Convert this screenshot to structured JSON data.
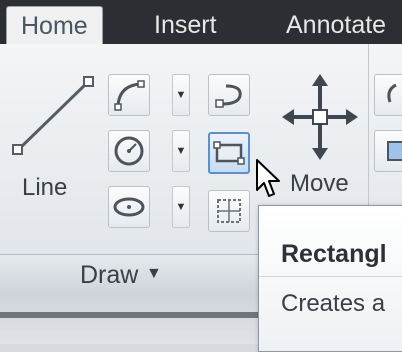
{
  "tabs": [
    {
      "label": "Home"
    },
    {
      "label": "Insert"
    },
    {
      "label": "Annotate"
    }
  ],
  "draw": {
    "line_label": "Line",
    "panel_title": "Draw",
    "panel_arrow": "▼",
    "dropdown_arrow": "▼"
  },
  "modify": {
    "move_label": "Move"
  },
  "tooltip": {
    "title": "Rectangl",
    "description": "Creates a"
  },
  "icons": [
    "line-icon",
    "polyline-icon",
    "circle-icon",
    "ellipse-icon",
    "rectangle-icon",
    "hatch-icon",
    "arc-icon",
    "move-icon"
  ]
}
